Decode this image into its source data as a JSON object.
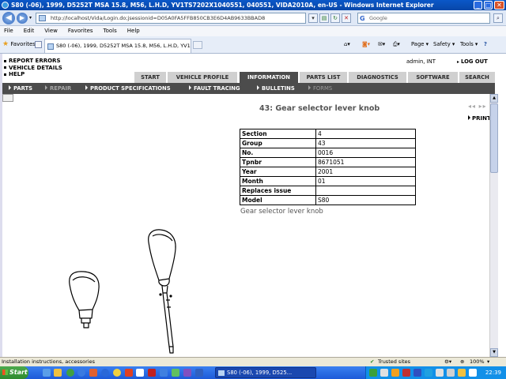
{
  "window": {
    "title": "S80 (-06), 1999, D5252T MSA 15.8, M56, L.H.D, YV1TS7202X1040551, 040551, VIDA2010A, en-US - Windows Internet Explorer",
    "minimize": "_",
    "maximize": "□",
    "close": "✕"
  },
  "browser": {
    "url": "http://localhost/Vida/Login.do;jsessionid=D05A0FA5FFB850CB3E6D4AB9633BBAD8",
    "search_placeholder": "Google",
    "menu": [
      "File",
      "Edit",
      "View",
      "Favorites",
      "Tools",
      "Help"
    ],
    "favorites_label": "Favorites",
    "tab_title": "S80 (-06), 1999, D5252T MSA 15.8, M56, L.H.D, YV1...",
    "page_menu": "Page ▾",
    "safety_menu": "Safety ▾",
    "tools_menu": "Tools ▾",
    "help_icon": "?"
  },
  "header": {
    "links": [
      "REPORT ERRORS",
      "VEHICLE DETAILS",
      "HELP"
    ],
    "user": "admin, INT",
    "logout": "LOG OUT"
  },
  "main_tabs": [
    {
      "label": "START",
      "active": false
    },
    {
      "label": "VEHICLE PROFILE",
      "active": false
    },
    {
      "label": "INFORMATION",
      "active": true
    },
    {
      "label": "PARTS LIST",
      "active": false
    },
    {
      "label": "DIAGNOSTICS",
      "active": false
    },
    {
      "label": "SOFTWARE",
      "active": false
    },
    {
      "label": "SEARCH",
      "active": false
    }
  ],
  "sub_tabs": [
    {
      "label": "PARTS",
      "state": "normal"
    },
    {
      "label": "REPAIR",
      "state": "active"
    },
    {
      "label": "PRODUCT SPECIFICATIONS",
      "state": "normal"
    },
    {
      "label": "FAULT TRACING",
      "state": "normal"
    },
    {
      "label": "BULLETINS",
      "state": "normal"
    },
    {
      "label": "FORMS",
      "state": "disabled"
    }
  ],
  "content": {
    "heading": "43: Gear selector lever knob",
    "pager": "◂◂ ▸▸",
    "print": "PRINT",
    "table": [
      {
        "key": "Section",
        "value": "4"
      },
      {
        "key": "Group",
        "value": "43"
      },
      {
        "key": "No.",
        "value": "0016"
      },
      {
        "key": "Tpnbr",
        "value": "8671051"
      },
      {
        "key": "Year",
        "value": "2001"
      },
      {
        "key": "Month",
        "value": "01"
      },
      {
        "key": "Replaces issue",
        "value": ""
      },
      {
        "key": "Model",
        "value": "S80"
      }
    ],
    "subheading": "Gear selector lever knob"
  },
  "status": {
    "text": "Installation instructions, accessories",
    "zone": "Trusted sites",
    "zoom": "100%"
  },
  "taskbar": {
    "start": "Start",
    "task": "S80 (-06), 1999, D525...",
    "time": "22:39"
  },
  "colors": {
    "titlebar": "#0846a8",
    "nav_active": "#4c4c4c",
    "nav_inactive": "#d0d0d0",
    "taskbar": "#245edb"
  }
}
